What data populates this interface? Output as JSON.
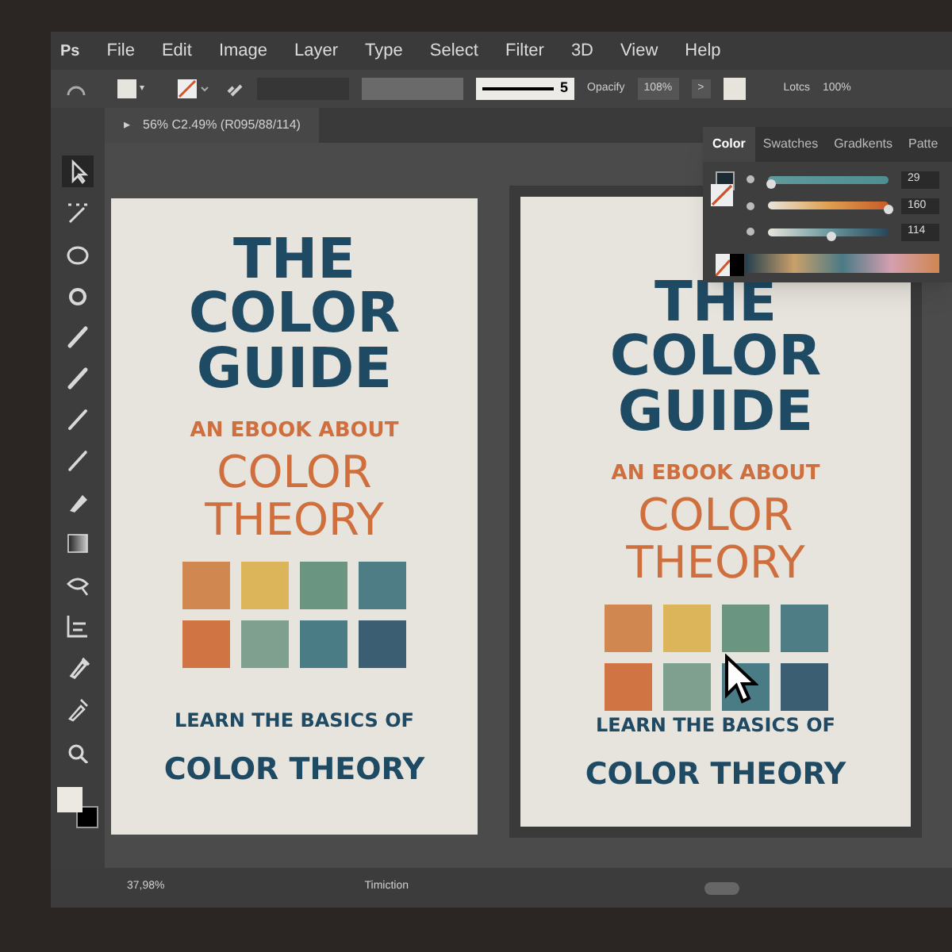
{
  "menu": {
    "logo": "Ps",
    "items": [
      "File",
      "Edit",
      "Image",
      "Layer",
      "Type",
      "Select",
      "Filter",
      "3D",
      "View",
      "Help"
    ]
  },
  "options": {
    "fill_caret": "▾",
    "stroke_value": "5",
    "opacity_label": "Opacify",
    "opacity_value": "108%",
    "arrow": ">",
    "locks_label": "Lotcs",
    "locks_value": "100%"
  },
  "document_tab": {
    "arrow": "▸",
    "title": "56% C2.49% (R095/88/114)"
  },
  "tools": [
    {
      "selected": true
    },
    {
      "selected": false
    },
    {
      "selected": false
    },
    {
      "selected": false
    },
    {
      "selected": false
    },
    {
      "selected": false
    },
    {
      "selected": false
    },
    {
      "selected": false
    },
    {
      "selected": false
    },
    {
      "selected": false
    },
    {
      "selected": false
    },
    {
      "selected": false
    },
    {
      "selected": false
    },
    {
      "selected": false
    },
    {
      "selected": false
    }
  ],
  "documents": [
    {
      "title_lines": [
        "THE",
        "COLOR",
        "GUIDE"
      ],
      "subtitle": "AN EBOOK ABOUT",
      "topic_lines": [
        "COLOR",
        "THEORY"
      ],
      "footer": "LEARN THE BASICS OF",
      "footer_title": "COLOR THEORY",
      "cursor": false
    },
    {
      "title_lines": [
        "THE",
        "COLOR",
        "GUIDE"
      ],
      "subtitle": "AN EBOOK ABOUT",
      "topic_lines": [
        "COLOR",
        "THEORY"
      ],
      "footer": "LEARN THE BASICS OF",
      "footer_title": "COLOR THEORY",
      "cursor": true
    }
  ],
  "swatches": [
    {
      "color": "#d08850"
    },
    {
      "color": "#dcb55a"
    },
    {
      "color": "#6a9580"
    },
    {
      "color": "#4f7d85"
    },
    {
      "color": "#cf7442"
    },
    {
      "color": "#7fa08f"
    },
    {
      "color": "#4a7c86"
    },
    {
      "color": "#3b5e72"
    }
  ],
  "color_panel": {
    "tabs": [
      {
        "label": "Color",
        "selected": true
      },
      {
        "label": "Swatches",
        "selected": false
      },
      {
        "label": "Gradkents",
        "selected": false
      },
      {
        "label": "Patte",
        "selected": false
      }
    ],
    "sliders": [
      {
        "level": 0.02,
        "reading": "29"
      },
      {
        "level": 1.0,
        "reading": "160"
      },
      {
        "level": 0.52,
        "reading": "114"
      }
    ]
  },
  "status_bar": {
    "zoom": "37,98%",
    "label": "Timiction"
  }
}
